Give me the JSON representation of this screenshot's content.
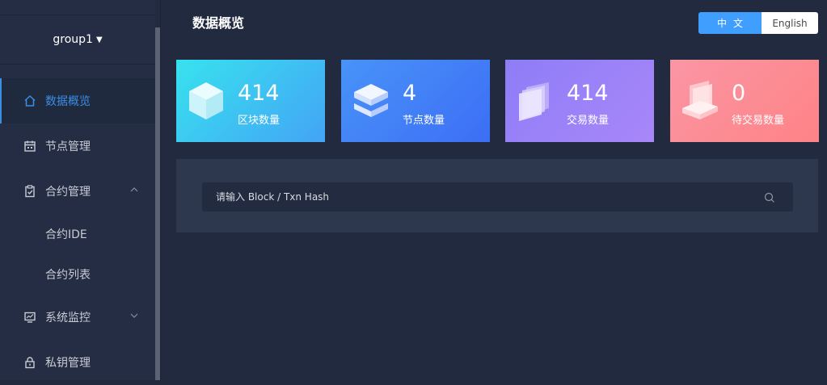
{
  "sidebar": {
    "group": {
      "label": "group1",
      "caret_icon": "caret-down-icon"
    },
    "items": [
      {
        "label": "数据概览",
        "icon": "home-icon",
        "active": true
      },
      {
        "label": "节点管理",
        "icon": "calendar-icon"
      },
      {
        "label": "合约管理",
        "icon": "clipboard-check-icon",
        "expanded": true,
        "children": [
          {
            "label": "合约IDE"
          },
          {
            "label": "合约列表"
          }
        ]
      },
      {
        "label": "系统监控",
        "icon": "monitor-icon",
        "expanded": false
      },
      {
        "label": "私钥管理",
        "icon": "lock-icon"
      }
    ]
  },
  "header": {
    "title": "数据概览",
    "lang": {
      "zh": "中文",
      "en": "English",
      "selected": "zh"
    }
  },
  "cards": [
    {
      "value": "414",
      "label": "区块数量",
      "icon": "cube-icon"
    },
    {
      "value": "4",
      "label": "节点数量",
      "icon": "server-stack-icon"
    },
    {
      "value": "414",
      "label": "交易数量",
      "icon": "cards-stack-icon"
    },
    {
      "value": "0",
      "label": "待交易数量",
      "icon": "pending-tray-icon"
    }
  ],
  "search": {
    "placeholder": "请输入 Block / Txn Hash",
    "icon": "search-icon"
  },
  "colors": {
    "accent": "#409eff",
    "sidebar_bg": "#242d43",
    "page_bg": "#212a3f",
    "card_blocks": [
      "#37e2ee",
      "#44a4f6"
    ],
    "card_nodes": [
      "#4893f8",
      "#3d6ef5"
    ],
    "card_txns": [
      "#8e7df7",
      "#a887f9"
    ],
    "card_pending": [
      "#fa96a4",
      "#fe8386"
    ]
  }
}
